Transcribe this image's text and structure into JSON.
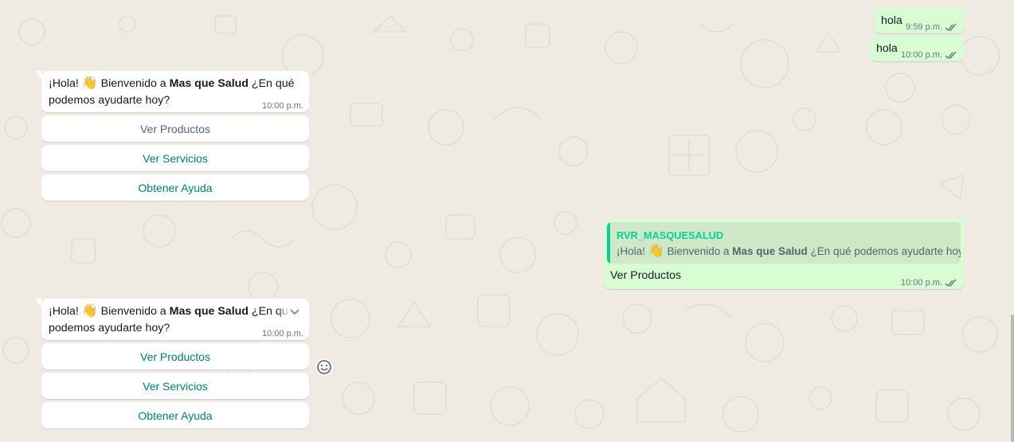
{
  "outgoing": [
    {
      "text": "hola",
      "time": "9:59 p.m."
    },
    {
      "text": "hola",
      "time": "10:00 p.m."
    }
  ],
  "incoming_1": {
    "text_before": "¡Hola! ",
    "emoji": "👋",
    "text_mid": " Bienvenido a ",
    "bold": "Mas que Salud",
    "text_after": " ¿En qué",
    "line2": "podemos ayudarte hoy?",
    "time": "10:00 p.m.",
    "buttons": [
      "Ver Productos",
      "Ver Servicios",
      "Obtener Ayuda"
    ]
  },
  "reply": {
    "quote_author": "RVR_MASQUESALUD",
    "quote_before": "¡Hola! ",
    "quote_emoji": "👋",
    "quote_mid": " Bienvenido a ",
    "quote_bold": "Mas que Salud",
    "quote_after": " ¿En qué podemos ayudarte hoy?",
    "text": "Ver Productos",
    "time": "10:00 p.m."
  },
  "incoming_2": {
    "text_before": "¡Hola! ",
    "emoji": "👋",
    "text_mid": " Bienvenido a ",
    "bold": "Mas que Salud",
    "text_after": " ¿En qu",
    "line2": "podemos ayudarte hoy?",
    "time": "10:00 p.m.",
    "buttons": [
      "Ver Productos",
      "Ver Servicios",
      "Obtener Ayuda"
    ]
  },
  "icons": {
    "read_receipt": "double-check-icon",
    "menu": "chevron-down-icon",
    "react": "emoji-smile-icon"
  },
  "colors": {
    "background": "#efeae2",
    "incoming": "#ffffff",
    "outgoing": "#d9fdd3",
    "read_ticks": "#53bdeb",
    "link_button": "#027eb5",
    "accent": "#06cf9c"
  }
}
